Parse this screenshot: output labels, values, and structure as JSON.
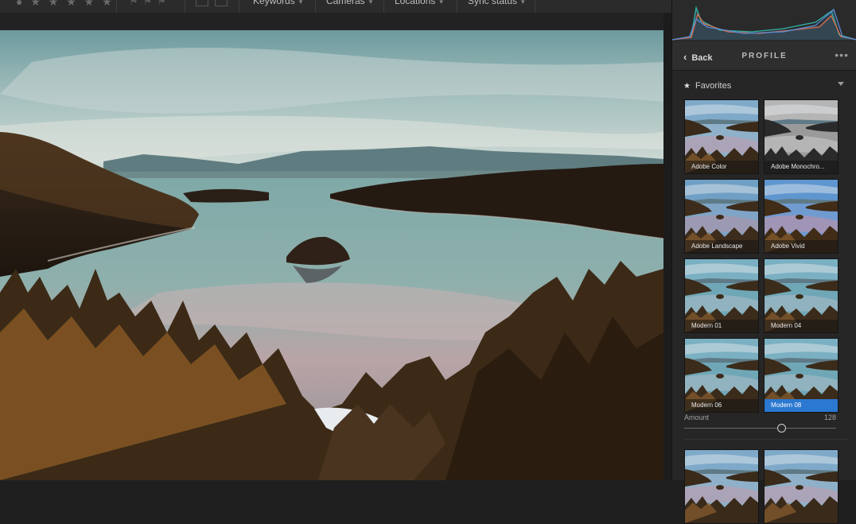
{
  "toolbar": {
    "stars": "● ★ ★ ★ ★ ★",
    "menus": [
      {
        "label": "Keywords"
      },
      {
        "label": "Cameras"
      },
      {
        "label": "Locations"
      },
      {
        "label": "Sync status"
      }
    ]
  },
  "panel": {
    "back_label": "Back",
    "title": "PROFILE",
    "more": "•••",
    "section_label": "Favorites",
    "profiles": [
      {
        "label": "Adobe Color",
        "style": "color",
        "selected": false
      },
      {
        "label": "Adobe Monochro...",
        "style": "mono",
        "selected": false
      },
      {
        "label": "Adobe Landscape",
        "style": "landscape",
        "selected": false
      },
      {
        "label": "Adobe Vivid",
        "style": "vivid",
        "selected": false
      },
      {
        "label": "Modern 01",
        "style": "modern",
        "selected": false
      },
      {
        "label": "Modern 04",
        "style": "modern",
        "selected": false
      },
      {
        "label": "Modern 06",
        "style": "modern",
        "selected": false
      },
      {
        "label": "Modern 08",
        "style": "modern",
        "selected": true
      },
      {
        "label": "",
        "style": "color",
        "selected": false
      },
      {
        "label": "",
        "style": "color",
        "selected": false
      }
    ],
    "amount_label": "Amount",
    "amount_value": "128",
    "amount_fraction": 0.64
  },
  "colors": {
    "accent": "#2b78d0",
    "panel_bg": "#262626"
  }
}
